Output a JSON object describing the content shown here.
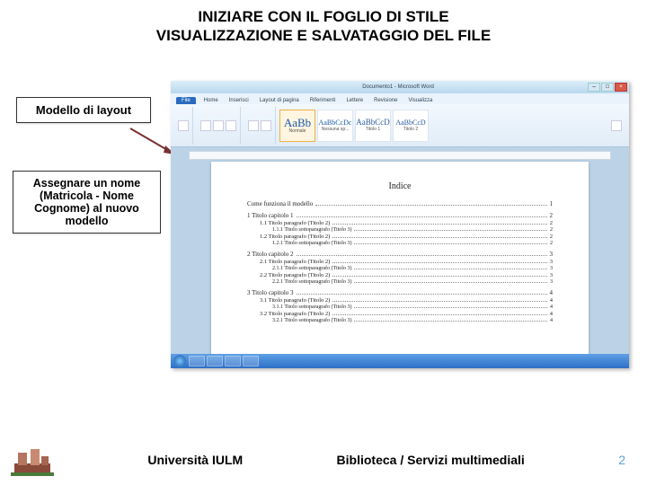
{
  "title_line1": "INIZIARE CON IL FOGLIO DI STILE",
  "title_line2": "VISUALIZZAZIONE E SALVATAGGIO DEL FILE",
  "callouts": {
    "c1": "Modello di layout",
    "c2": "Assegnare un nome (Matricola - Nome Cognome) al nuovo modello"
  },
  "word": {
    "titlebar_doc": "Documento1 - Microsoft Word",
    "tabs": {
      "file": "File",
      "home": "Home",
      "insert": "Inserisci",
      "layout": "Layout di pagina",
      "references": "Riferimenti",
      "mailings": "Lettere",
      "review": "Revisione",
      "view": "Visualizza"
    },
    "styles": {
      "s1_glyph": "AaBb",
      "s1_label": "Normale",
      "s2_glyph": "AaBbCcDc",
      "s2_label": "Nessuna sp...",
      "s3_glyph": "AaBbCcD",
      "s3_label": "Titolo 1",
      "s4_glyph": "AaBbCcD",
      "s4_label": "Titolo 2"
    },
    "doc_heading": "Indice",
    "toc": [
      {
        "lvl": "lvl1",
        "text": "Come funziona il modello",
        "page": "1"
      },
      {
        "lvl": "lvl1",
        "text": "1 Titolo capitolo 1",
        "page": "2"
      },
      {
        "lvl": "lvl2",
        "text": "1.1 Titolo paragrafo (Titolo 2)",
        "page": "2"
      },
      {
        "lvl": "lvl3",
        "text": "1.1.1 Titolo sottoparagrafo (Titolo 3)",
        "page": "2"
      },
      {
        "lvl": "lvl2",
        "text": "1.2 Titolo paragrafo (Titolo 2)",
        "page": "2"
      },
      {
        "lvl": "lvl3",
        "text": "1.2.1 Titolo sottoparagrafo (Titolo 3)",
        "page": "2"
      },
      {
        "lvl": "lvl1",
        "text": "2 Titolo capitolo 2",
        "page": "3"
      },
      {
        "lvl": "lvl2",
        "text": "2.1 Titolo paragrafo (Titolo 2)",
        "page": "3"
      },
      {
        "lvl": "lvl3",
        "text": "2.1.1 Titolo sottoparagrafo (Titolo 3)",
        "page": "3"
      },
      {
        "lvl": "lvl2",
        "text": "2.2 Titolo paragrafo (Titolo 2)",
        "page": "3"
      },
      {
        "lvl": "lvl3",
        "text": "2.2.1 Titolo sottoparagrafo (Titolo 3)",
        "page": "3"
      },
      {
        "lvl": "lvl1",
        "text": "3 Titolo capitolo 3",
        "page": "4"
      },
      {
        "lvl": "lvl2",
        "text": "3.1 Titolo paragrafo (Titolo 2)",
        "page": "4"
      },
      {
        "lvl": "lvl3",
        "text": "3.1.1 Titolo sottoparagrafo (Titolo 3)",
        "page": "4"
      },
      {
        "lvl": "lvl2",
        "text": "3.2 Titolo paragrafo (Titolo 2)",
        "page": "4"
      },
      {
        "lvl": "lvl3",
        "text": "3.2.1 Titolo sottoparagrafo (Titolo 3)",
        "page": "4"
      }
    ]
  },
  "footer": {
    "uni": "Università IULM",
    "lib": "Biblioteca / Servizi multimediali",
    "page": "2"
  }
}
